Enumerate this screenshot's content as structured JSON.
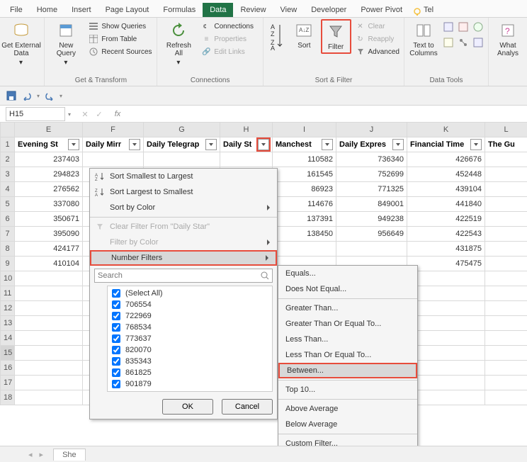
{
  "tabs": {
    "file": "File",
    "home": "Home",
    "insert": "Insert",
    "page_layout": "Page Layout",
    "formulas": "Formulas",
    "data": "Data",
    "review": "Review",
    "view": "View",
    "developer": "Developer",
    "power_pivot": "Power Pivot",
    "tell": "Tel"
  },
  "ribbon": {
    "get_external": {
      "label": "Get External\nData",
      "drop": "▾",
      "group": ""
    },
    "get_transform": {
      "new_query": "New\nQuery",
      "show_queries": "Show Queries",
      "from_table": "From Table",
      "recent_sources": "Recent Sources",
      "group": "Get & Transform"
    },
    "connections": {
      "refresh": "Refresh\nAll",
      "connections": "Connections",
      "properties": "Properties",
      "edit_links": "Edit Links",
      "group": "Connections"
    },
    "sort_filter": {
      "sort": "Sort",
      "filter": "Filter",
      "clear": "Clear",
      "reapply": "Reapply",
      "advanced": "Advanced",
      "group": "Sort & Filter"
    },
    "data_tools": {
      "text_to_columns": "Text to\nColumns",
      "group": "Data Tools"
    },
    "whatif": {
      "label": "What\nAnalys"
    }
  },
  "namebox": {
    "cell": "H15"
  },
  "columns": [
    "E",
    "F",
    "G",
    "H",
    "I",
    "J",
    "K",
    "L"
  ],
  "headers": {
    "E": "Evening St",
    "F": "Daily Mirr",
    "G": "Daily Telegrap",
    "H": "Daily St",
    "I": "Manchest",
    "J": "Daily Expres",
    "K": "Financial Time",
    "L": "The Gu"
  },
  "rows": [
    {
      "n": 2,
      "E": "237403",
      "I": "110582",
      "J": "736340",
      "K": "426676"
    },
    {
      "n": 3,
      "E": "294823",
      "I": "161545",
      "J": "752699",
      "K": "452448"
    },
    {
      "n": 4,
      "E": "276562",
      "I": "86923",
      "J": "771325",
      "K": "439104"
    },
    {
      "n": 5,
      "E": "337080",
      "I": "114676",
      "J": "849001",
      "K": "441840"
    },
    {
      "n": 6,
      "E": "350671",
      "I": "137391",
      "J": "949238",
      "K": "422519"
    },
    {
      "n": 7,
      "E": "395090",
      "I": "138450",
      "J": "956649",
      "K": "422543"
    },
    {
      "n": 8,
      "E": "424177",
      "I": "",
      "J": "",
      "K": "431875"
    },
    {
      "n": 9,
      "E": "410104",
      "I": "",
      "J": "",
      "K": "475475"
    }
  ],
  "filter_menu": {
    "sort_asc": "Sort Smallest to Largest",
    "sort_desc": "Sort Largest to Smallest",
    "sort_color": "Sort by Color",
    "clear": "Clear Filter From \"Daily Star\"",
    "filter_color": "Filter by Color",
    "number_filters": "Number Filters",
    "search_placeholder": "Search",
    "select_all": "(Select All)",
    "items": [
      "706554",
      "722969",
      "768534",
      "773637",
      "820070",
      "835343",
      "861825",
      "901879"
    ],
    "ok": "OK",
    "cancel": "Cancel"
  },
  "number_filters": {
    "equals": "Equals...",
    "not_equal": "Does Not Equal...",
    "greater": "Greater Than...",
    "greater_eq": "Greater Than Or Equal To...",
    "less": "Less Than...",
    "less_eq": "Less Than Or Equal To...",
    "between": "Between...",
    "top10": "Top 10...",
    "above_avg": "Above Average",
    "below_avg": "Below Average",
    "custom": "Custom Filter..."
  },
  "sheet_tab": "She",
  "highlight_color": "#e74c3c"
}
